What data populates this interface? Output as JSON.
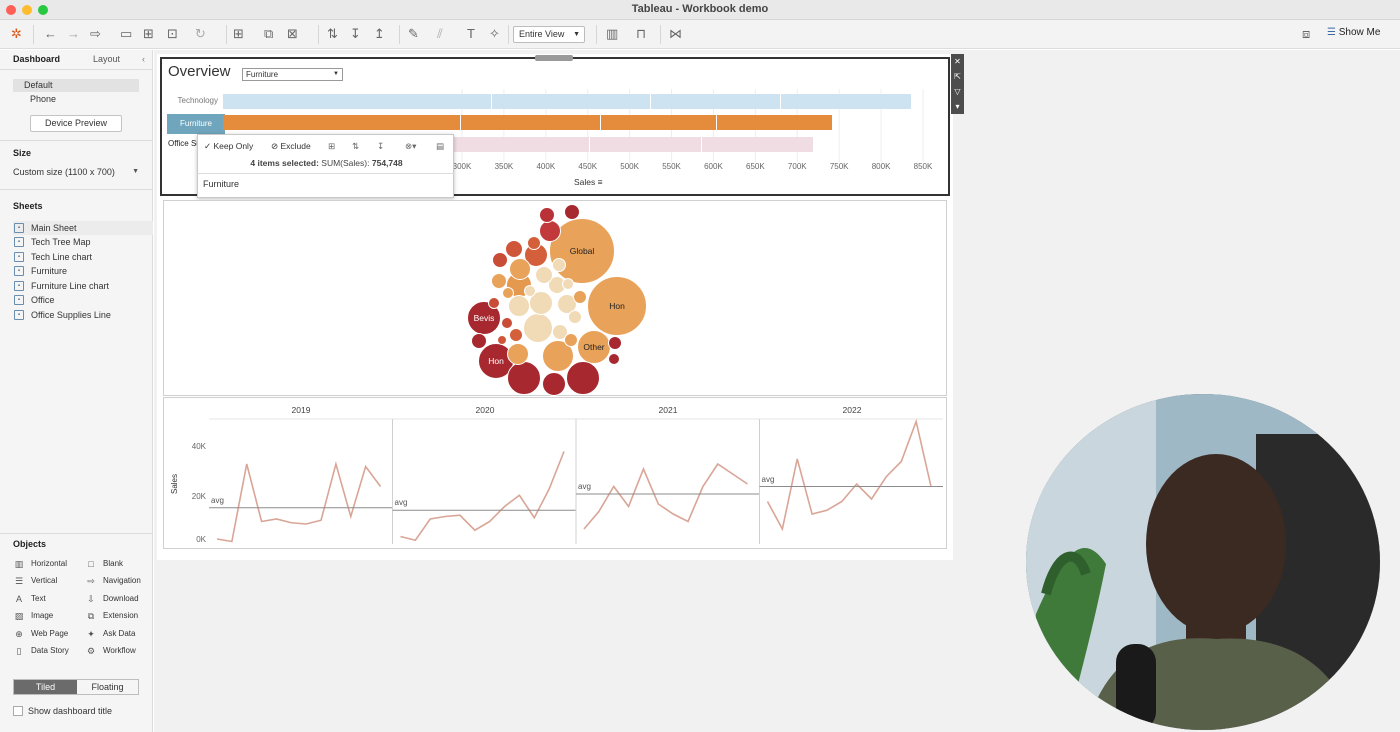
{
  "window": {
    "title": "Tableau - Workbook demo"
  },
  "toolbar": {
    "view_select": "Entire View",
    "show_me": "Show Me"
  },
  "left_panel": {
    "tabs": {
      "dashboard": "Dashboard",
      "layout": "Layout"
    },
    "devices": {
      "default": "Default",
      "phone": "Phone"
    },
    "device_preview": "Device Preview",
    "size": {
      "title": "Size",
      "value": "Custom size (1100 x 700)"
    },
    "sheets": {
      "title": "Sheets",
      "items": [
        "Main Sheet",
        "Tech Tree Map",
        "Tech Line chart",
        "Furniture",
        "Furniture Line chart",
        "Office",
        "Office Supplies Line"
      ]
    },
    "objects": {
      "title": "Objects",
      "items": [
        "Horizontal",
        "Blank",
        "Vertical",
        "Navigation",
        "Text",
        "Download",
        "Image",
        "Extension",
        "Web Page",
        "Ask Data",
        "Data Story",
        "Workflow"
      ]
    },
    "layout_toggle": {
      "tiled": "Tiled",
      "floating": "Floating"
    },
    "show_title": "Show dashboard title"
  },
  "overview": {
    "title": "Overview",
    "filter_value": "Furniture",
    "categories": [
      "Technology",
      "Furniture",
      "Office Supplies"
    ],
    "x_axis_title": "Sales",
    "x_ticks": [
      "300K",
      "350K",
      "400K",
      "450K",
      "500K",
      "550K",
      "600K",
      "650K",
      "700K",
      "750K",
      "800K",
      "850K"
    ]
  },
  "tooltip": {
    "keep_only": "Keep Only",
    "exclude": "Exclude",
    "summary_count": "4 items selected:",
    "summary_metric": "SUM(Sales):",
    "summary_value": "754,748",
    "field_value": "Furniture"
  },
  "bubbles": {
    "labels": [
      "Global",
      "Hon",
      "Bevis",
      "Other",
      "Hon"
    ]
  },
  "line_chart": {
    "years": [
      "2019",
      "2020",
      "2021",
      "2022"
    ],
    "y_ticks": [
      "40K",
      "20K",
      "0K"
    ],
    "y_title": "Sales",
    "avg_label": "avg"
  },
  "chart_data": [
    {
      "type": "bar",
      "categories": [
        "Technology",
        "Furniture",
        "Office Supplies"
      ],
      "values": [
        836000,
        741000,
        719000
      ],
      "xlabel": "Sales",
      "xlim": [
        0,
        870000
      ]
    },
    {
      "type": "line",
      "x": [
        "2019",
        "2020",
        "2021",
        "2022"
      ],
      "ylabel": "Sales",
      "ylim": [
        0,
        50000
      ],
      "series": [
        {
          "values": [
            2000,
            1000,
            32000,
            9000,
            10000,
            8500,
            8000,
            9500,
            32000,
            11000,
            31000,
            23000
          ]
        },
        {
          "values": [
            3000,
            1500,
            10000,
            11000,
            11500,
            5500,
            9000,
            15000,
            19500,
            10500,
            22000,
            37000
          ]
        },
        {
          "values": [
            6000,
            13000,
            23000,
            15000,
            30000,
            16000,
            12000,
            9000,
            23000,
            32000,
            28000,
            24000
          ]
        },
        {
          "values": [
            17000,
            6000,
            34000,
            12000,
            13500,
            17000,
            24000,
            18000,
            27000,
            33000,
            49000,
            23000
          ]
        }
      ],
      "avg": [
        14500,
        13500,
        20000,
        23000
      ]
    }
  ]
}
